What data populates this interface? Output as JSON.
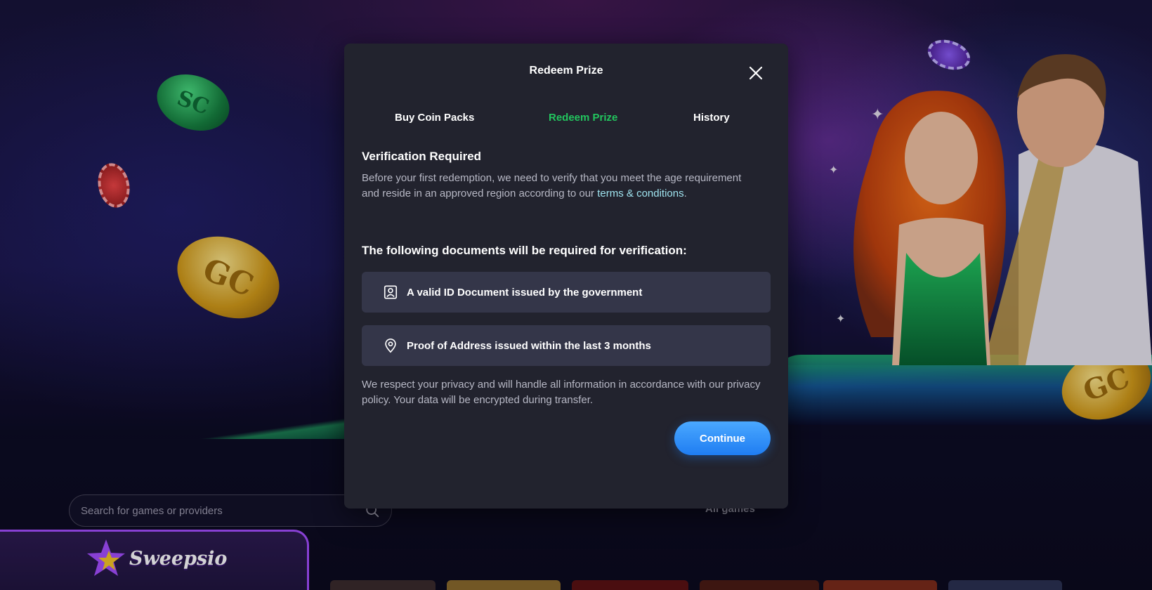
{
  "background": {
    "brand_colors": {
      "accent_green": "#22c55e",
      "button_blue": "#1f7df2",
      "logo_purple": "#a54dff"
    }
  },
  "page": {
    "search": {
      "placeholder": "Search for games or providers"
    },
    "all_games_label": "All games",
    "logo": {
      "name": "Sweepsio"
    }
  },
  "modal": {
    "title": "Redeem Prize",
    "tabs": [
      {
        "label": "Buy Coin Packs",
        "active": false
      },
      {
        "label": "Redeem Prize",
        "active": true
      },
      {
        "label": "History",
        "active": false
      }
    ],
    "section_title": "Verification Required",
    "intro_text": "Before your first redemption, we need to verify that you meet the age requirement and reside in an approved region according to our ",
    "terms_link": "terms & conditions",
    "intro_end": ".",
    "documents_title": "The following documents will be required for verification:",
    "documents": [
      {
        "icon": "id-card-icon",
        "label": "A valid ID Document issued by the government"
      },
      {
        "icon": "location-pin-icon",
        "label": "Proof of Address issued within the last 3 months"
      }
    ],
    "privacy_text": "We respect your privacy and will handle all information in accordance with our privacy policy. Your data will be encrypted during transfer.",
    "continue_label": "Continue"
  }
}
